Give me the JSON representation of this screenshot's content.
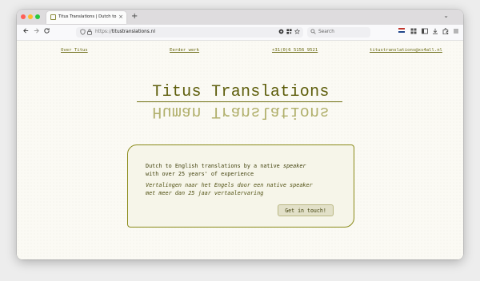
{
  "browser": {
    "tab_title": "Titus Translations | Dutch to En",
    "tab_close": "×",
    "new_tab": "+",
    "tabs_menu": "⌄",
    "url_scheme": "https://",
    "url_host": "titustranslations.nl",
    "search_placeholder": "Search"
  },
  "nav": {
    "links": [
      "Over Titus",
      "Eerder werk",
      "+31(0)6 5156 9521",
      "titustranslations@xs4all.nl"
    ]
  },
  "logo": {
    "title": "Titus Translations",
    "mirror_text": "Human Translations"
  },
  "card": {
    "english_line1": "Dutch to English translations by a native",
    "english_em": "speaker",
    "english_line2": "with over 25 years' of experience",
    "dutch_line1": "Vertalingen naar het Engels door een native speaker",
    "dutch_line2": "met meer dan 25 jaar vertaalervaring",
    "button_label": "Get in touch!"
  },
  "colors": {
    "accent": "#6a6a12",
    "page_background": "#fbfaf4"
  }
}
